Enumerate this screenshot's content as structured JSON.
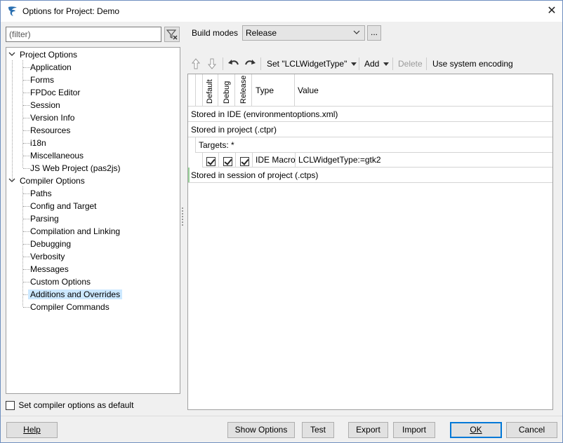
{
  "window": {
    "title": "Options for Project: Demo"
  },
  "filter": {
    "placeholder": "(filter)"
  },
  "tree": {
    "project_options": {
      "label": "Project Options",
      "items": [
        "Application",
        "Forms",
        "FPDoc Editor",
        "Session",
        "Version Info",
        "Resources",
        "i18n",
        "Miscellaneous",
        "JS Web Project (pas2js)"
      ]
    },
    "compiler_options": {
      "label": "Compiler Options",
      "items": [
        "Paths",
        "Config and Target",
        "Parsing",
        "Compilation and Linking",
        "Debugging",
        "Verbosity",
        "Messages",
        "Custom Options",
        "Additions and Overrides",
        "Compiler Commands"
      ]
    },
    "selected": "Additions and Overrides"
  },
  "default_checkbox": {
    "label": "Set compiler options as default",
    "checked": false
  },
  "build_modes": {
    "label": "Build modes",
    "value": "Release",
    "more_label": "..."
  },
  "toolbar": {
    "set_label": "Set \"LCLWidgetType\"",
    "add_label": "Add",
    "delete_label": "Delete",
    "encoding_label": "Use system encoding"
  },
  "grid": {
    "columns": {
      "default": "Default",
      "debug": "Debug",
      "release": "Release",
      "type": "Type",
      "value": "Value"
    },
    "stored_ide": "Stored in IDE (environmentoptions.xml)",
    "stored_project": "Stored in project (.ctpr)",
    "targets": "Targets: *",
    "row": {
      "default": true,
      "debug": true,
      "release": true,
      "type": "IDE Macro",
      "value": "LCLWidgetType:=gtk2"
    },
    "stored_session": "Stored in session of project (.ctps)"
  },
  "buttons": {
    "help": "Help",
    "show_options": "Show Options",
    "test": "Test",
    "export": "Export",
    "import": "Import",
    "ok": "OK",
    "cancel": "Cancel"
  }
}
